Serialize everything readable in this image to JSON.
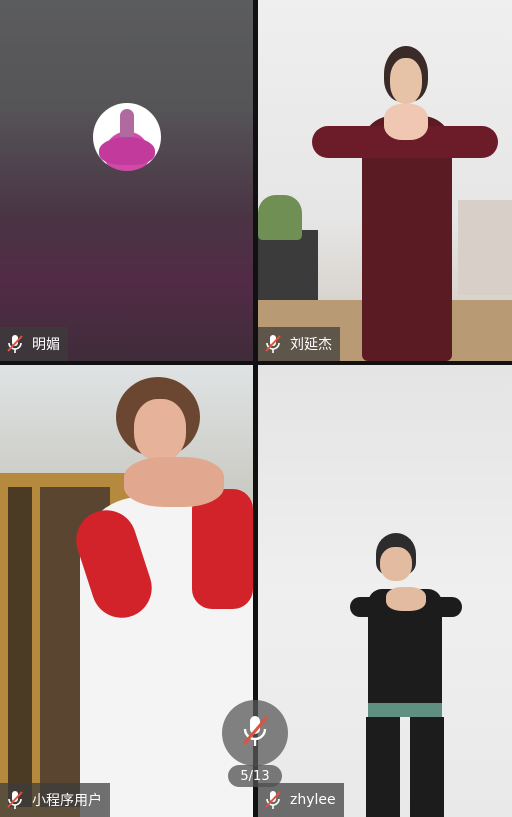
{
  "participants": [
    {
      "name": "明媚",
      "mic": "muted",
      "video": "off"
    },
    {
      "name": "刘延杰",
      "mic": "muted",
      "video": "on"
    },
    {
      "name": "小程序用户",
      "mic": "muted",
      "video": "on"
    },
    {
      "name": "zhylee",
      "mic": "muted",
      "video": "on"
    }
  ],
  "controls": {
    "mic_button_state": "muted",
    "page_indicator": "5/13"
  },
  "colors": {
    "tag_bg": "#3c3c3c",
    "muted_icon": "#e0523e"
  }
}
